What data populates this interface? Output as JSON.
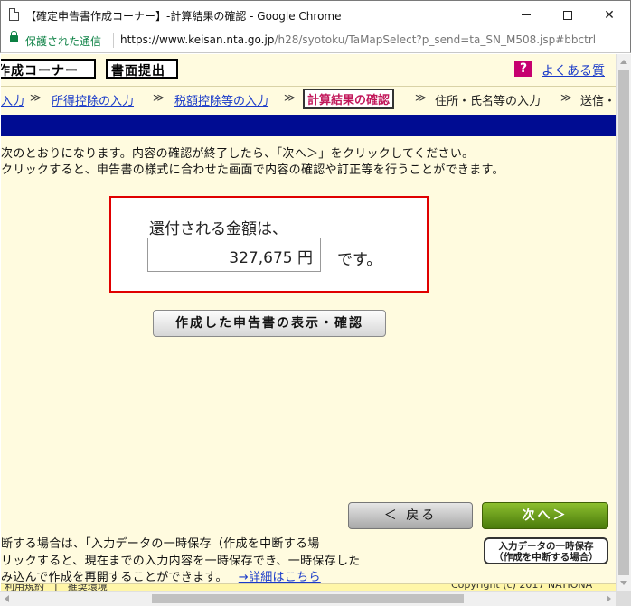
{
  "window": {
    "title": "【確定申告書作成コーナー】-計算結果の確認 - Google Chrome",
    "minimize_label": "—",
    "close_label": "✕"
  },
  "address": {
    "secure_label": "保護された通信",
    "url_host": "https://www.keisan.nta.go.jp",
    "url_path": "/h28/syotoku/TaMapSelect?p_send=ta_SN_M508.jsp#bbctrl"
  },
  "header": {
    "corner_label": "作成コーナー",
    "submit_label": "書面提出",
    "help_icon": "?",
    "faq_label": "よくある質"
  },
  "steps": {
    "items": [
      {
        "label": "入力",
        "type": "link"
      },
      {
        "label": "所得控除の入力",
        "type": "link"
      },
      {
        "label": "税額控除等の入力",
        "type": "link"
      },
      {
        "label": "計算結果の確認",
        "type": "current"
      },
      {
        "label": "住所・氏名等の入力",
        "type": "plain"
      },
      {
        "label": "送信・",
        "type": "plain"
      }
    ],
    "arrow": "≫"
  },
  "instructions": {
    "line1": "次のとおりになります。内容の確認が終了したら、「次へ＞」をクリックしてください。",
    "line2": "クリックすると、申告書の様式に合わせた画面で内容の確認や訂正等を行うことができます。"
  },
  "result": {
    "caption": "還付される金額は、",
    "amount": "327,675 円",
    "suffix": "です。"
  },
  "buttons": {
    "view_label": "作成した申告書の表示・確認",
    "back_label": "＜ 戻る",
    "next_label": "次へ＞",
    "save_line1": "入力データの一時保存",
    "save_line2": "（作成を中断する場合）"
  },
  "footer_text": {
    "line1": "断する場合は、「入力データの一時保存（作成を中断する場",
    "line2": "リックすると、現在までの入力内容を一時保存でき、一時保存した",
    "line3": "み込んで作成を再開することができます。",
    "details_link": "→詳細はこちら",
    "bottom_left": "利用規約　|　推奨環境",
    "bottom_right": "Copyright (c) 2017 NATIONA"
  },
  "colors": {
    "page_bg": "#fffbdf",
    "blue_bar": "#000c92",
    "link": "#1a3bc9",
    "current_step": "#c2185b",
    "result_border": "#e00000",
    "next_button": "#6b9a1c",
    "secure_green": "#0b8043"
  }
}
